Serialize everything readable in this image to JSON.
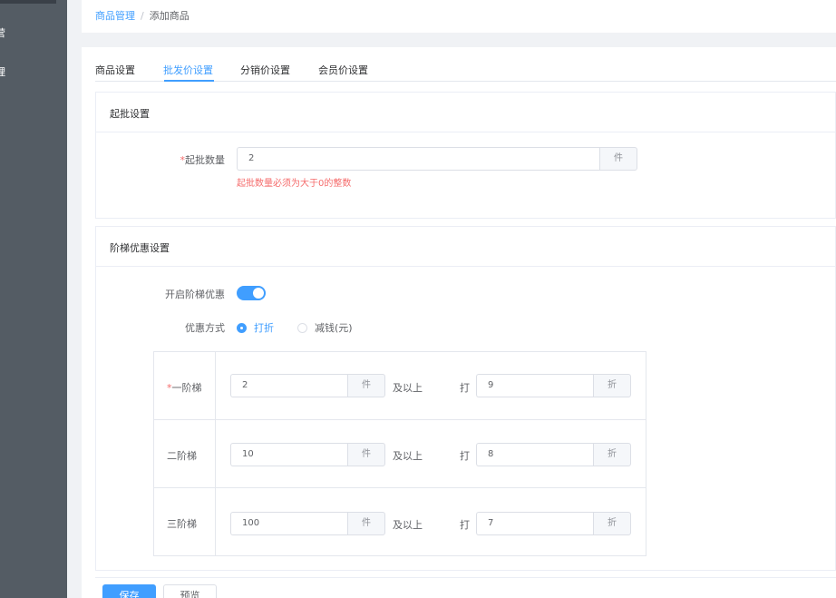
{
  "sidebar": {
    "glyphs": [
      "营",
      "理"
    ]
  },
  "breadcrumb": {
    "parent": "商品管理",
    "separator": "/",
    "current": "添加商品"
  },
  "tabs": [
    {
      "label": "商品设置",
      "active": false
    },
    {
      "label": "批发价设置",
      "active": true
    },
    {
      "label": "分销价设置",
      "active": false
    },
    {
      "label": "会员价设置",
      "active": false
    }
  ],
  "min_batch": {
    "title": "起批设置",
    "required_mark": "*",
    "label": "起批数量",
    "value": "2",
    "unit": "件",
    "error": "起批数量必须为大于0的整数"
  },
  "tiered": {
    "title": "阶梯优惠设置",
    "enable_label": "开启阶梯优惠",
    "enabled": true,
    "mode_label": "优惠方式",
    "modes": [
      {
        "label": "打折",
        "checked": true
      },
      {
        "label": "减钱(元)",
        "checked": false
      }
    ],
    "tiers": [
      {
        "required": true,
        "label": "一阶梯",
        "qty": "2",
        "qty_unit": "件",
        "above": "及以上",
        "discount_prefix": "打",
        "discount": "9",
        "discount_unit": "折"
      },
      {
        "required": false,
        "label": "二阶梯",
        "qty": "10",
        "qty_unit": "件",
        "above": "及以上",
        "discount_prefix": "打",
        "discount": "8",
        "discount_unit": "折"
      },
      {
        "required": false,
        "label": "三阶梯",
        "qty": "100",
        "qty_unit": "件",
        "above": "及以上",
        "discount_prefix": "打",
        "discount": "7",
        "discount_unit": "折"
      }
    ]
  },
  "actions": {
    "save": "保存",
    "preview": "预览"
  },
  "colors": {
    "primary": "#409eff",
    "danger": "#f56c6c",
    "sidebar": "#545c64"
  }
}
